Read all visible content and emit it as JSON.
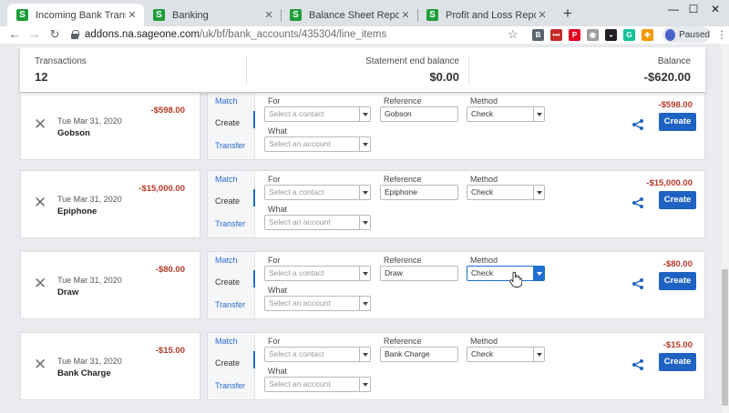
{
  "browser": {
    "tabs": [
      {
        "title": "Incoming Bank Transactions",
        "favicon": "S",
        "active": true
      },
      {
        "title": "Banking",
        "favicon": "S",
        "active": false
      },
      {
        "title": "Balance Sheet Report",
        "favicon": "S",
        "active": false
      },
      {
        "title": "Profit and Loss Report",
        "favicon": "S",
        "active": false
      }
    ],
    "url_host": "addons.na.sageone.com",
    "url_path": "/uk/bf/bank_accounts/435304/line_items",
    "profile_label": "Paused",
    "extensions": [
      {
        "icon": "bookmark-icon",
        "glyph": "B",
        "color": "#5a6470"
      },
      {
        "icon": "lastpass-icon",
        "glyph": "•••",
        "color": "#c62828"
      },
      {
        "icon": "pinterest-icon",
        "glyph": "P",
        "color": "#e60023"
      },
      {
        "icon": "ghost-icon",
        "glyph": "◉",
        "color": "#9e9e9e"
      },
      {
        "icon": "mask-icon",
        "glyph": "◒",
        "color": "#202124"
      },
      {
        "icon": "grammarly-icon",
        "glyph": "G",
        "color": "#15c39a"
      },
      {
        "icon": "puzzle-icon",
        "glyph": "✚",
        "color": "#f29900"
      }
    ]
  },
  "summary": {
    "transactions_label": "Transactions",
    "transactions_value": "12",
    "statement_label": "Statement end balance",
    "statement_value": "$0.00",
    "balance_label": "Balance",
    "balance_value": "-$620.00"
  },
  "labels": {
    "match": "Match",
    "create": "Create",
    "transfer": "Transfer",
    "for": "For",
    "what": "What",
    "reference": "Reference",
    "method": "Method",
    "contact_placeholder": "Select a contact",
    "account_placeholder": "Select an account",
    "create_button": "Create"
  },
  "transactions": [
    {
      "date": "Tue Mar 31, 2020",
      "name": "Gobson",
      "amount": "-$598.00",
      "reference": "Gobson",
      "method": "Check",
      "method_focused": false
    },
    {
      "date": "Tue Mar 31, 2020",
      "name": "Epiphone",
      "amount": "-$15,000.00",
      "reference": "Epiphone",
      "method": "Check",
      "method_focused": false
    },
    {
      "date": "Tue Mar 31, 2020",
      "name": "Draw",
      "amount": "-$80.00",
      "reference": "Draw",
      "method": "Check",
      "method_focused": true
    },
    {
      "date": "Tue Mar 31, 2020",
      "name": "Bank Charge",
      "amount": "-$15.00",
      "reference": "Bank Charge",
      "method": "Check",
      "method_focused": false
    }
  ],
  "colors": {
    "accent": "#1f63c2",
    "negative_amount": "#b43a2a",
    "brand": "#1f9d3a"
  }
}
